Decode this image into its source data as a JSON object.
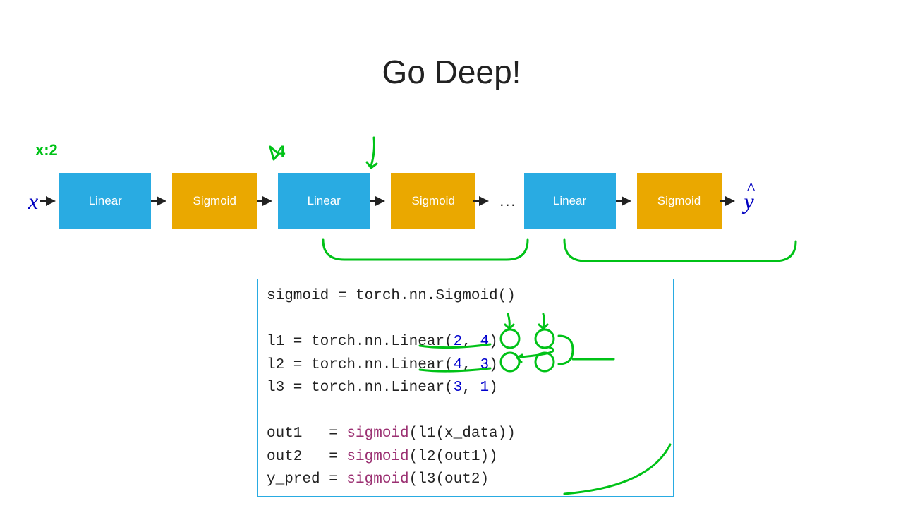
{
  "title": "Go Deep!",
  "flow": {
    "input": "x",
    "output": "y",
    "blocks": [
      "Linear",
      "Sigmoid",
      "Linear",
      "Sigmoid",
      "Linear",
      "Sigmoid"
    ],
    "ellipsis": "..."
  },
  "annotations": {
    "x_label": "x:2",
    "sigmoid1_label": "4"
  },
  "code": {
    "l0": "sigmoid = torch.nn.Sigmoid()",
    "l1_pre": "l1 = torch.nn.Linear(",
    "l1_a": "2",
    "l1_sep": ", ",
    "l1_b": "4",
    "l1_post": ")",
    "l2_pre": "l2 = torch.nn.Linear(",
    "l2_a": "4",
    "l2_b": "3",
    "l2_post": ")",
    "l3_pre": "l3 = torch.nn.Linear(",
    "l3_a": "3",
    "l3_b": "1",
    "l3_post": ")",
    "o1_pre": "out1   = ",
    "o1_fn": "sigmoid",
    "o1_post": "(l1(x_data))",
    "o2_pre": "out2   = ",
    "o2_fn": "sigmoid",
    "o2_post": "(l2(out1))",
    "yp_pre": "y_pred = ",
    "yp_fn": "sigmoid",
    "yp_post": "(l3(out2)"
  }
}
